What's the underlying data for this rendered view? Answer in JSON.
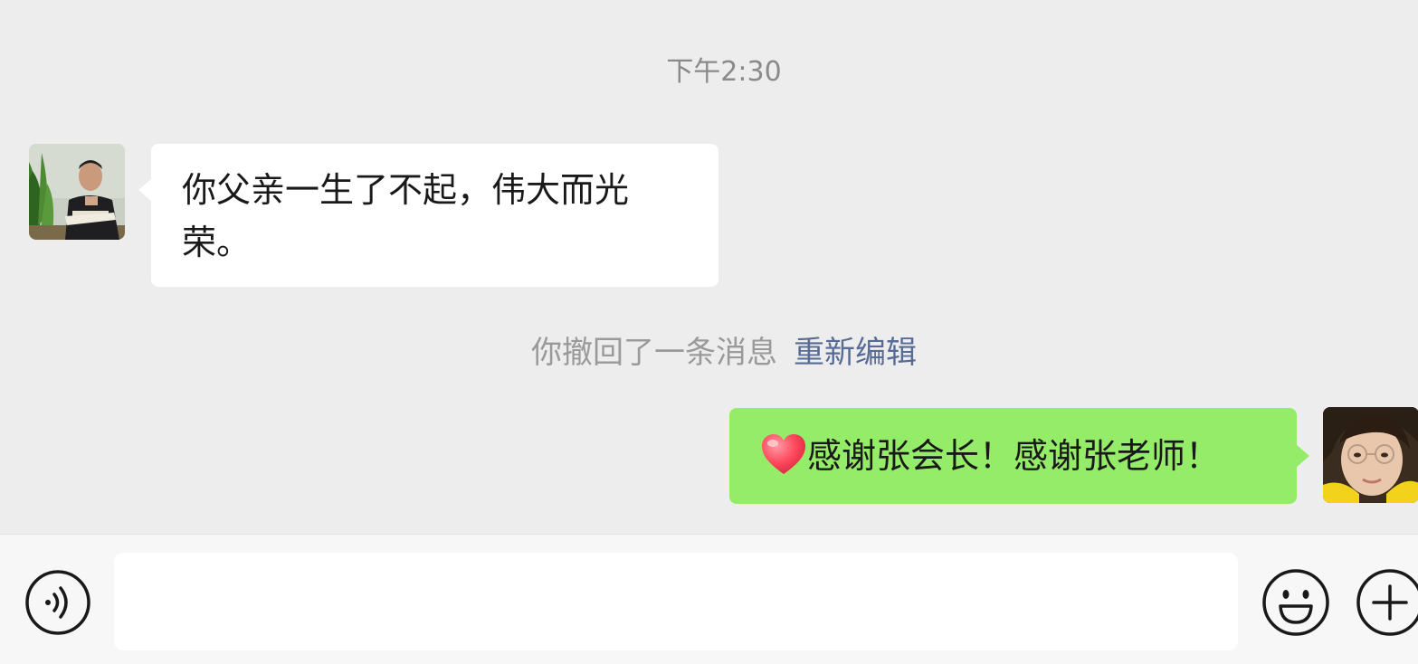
{
  "chat": {
    "timestamp": "下午2:30",
    "messages": [
      {
        "sender": "other",
        "text": "你父亲一生了不起，伟大而光荣。"
      },
      {
        "sender": "self",
        "emoji": "heart-icon",
        "text": "感谢张会长！感谢张老师！"
      }
    ],
    "recall_notice": {
      "text": "你撤回了一条消息",
      "action_label": "重新编辑"
    }
  },
  "input_bar": {
    "value": "",
    "placeholder": "",
    "icons": [
      "voice-icon",
      "emoji-face-icon",
      "plus-icon"
    ]
  },
  "colors": {
    "background": "#ededed",
    "incoming_bubble": "#ffffff",
    "outgoing_bubble": "#95ec69",
    "link": "#576b95",
    "system_text": "#9a9a9a"
  }
}
